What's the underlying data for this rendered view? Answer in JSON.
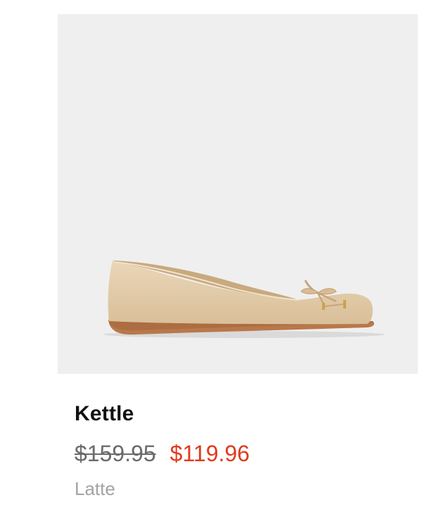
{
  "product": {
    "name": "Kettle",
    "original_price": "$159.95",
    "sale_price": "$119.96",
    "color": "Latte",
    "image_icon": "ballet-flat-shoe-image"
  },
  "colors": {
    "image_background": "#efefef",
    "name_text": "#111111",
    "original_price_text": "#6b6b6b",
    "sale_price_text": "#e03a1f",
    "color_text": "#a3a3a3",
    "shoe_leather": "#e2caa8",
    "shoe_sole": "#b8784a"
  }
}
